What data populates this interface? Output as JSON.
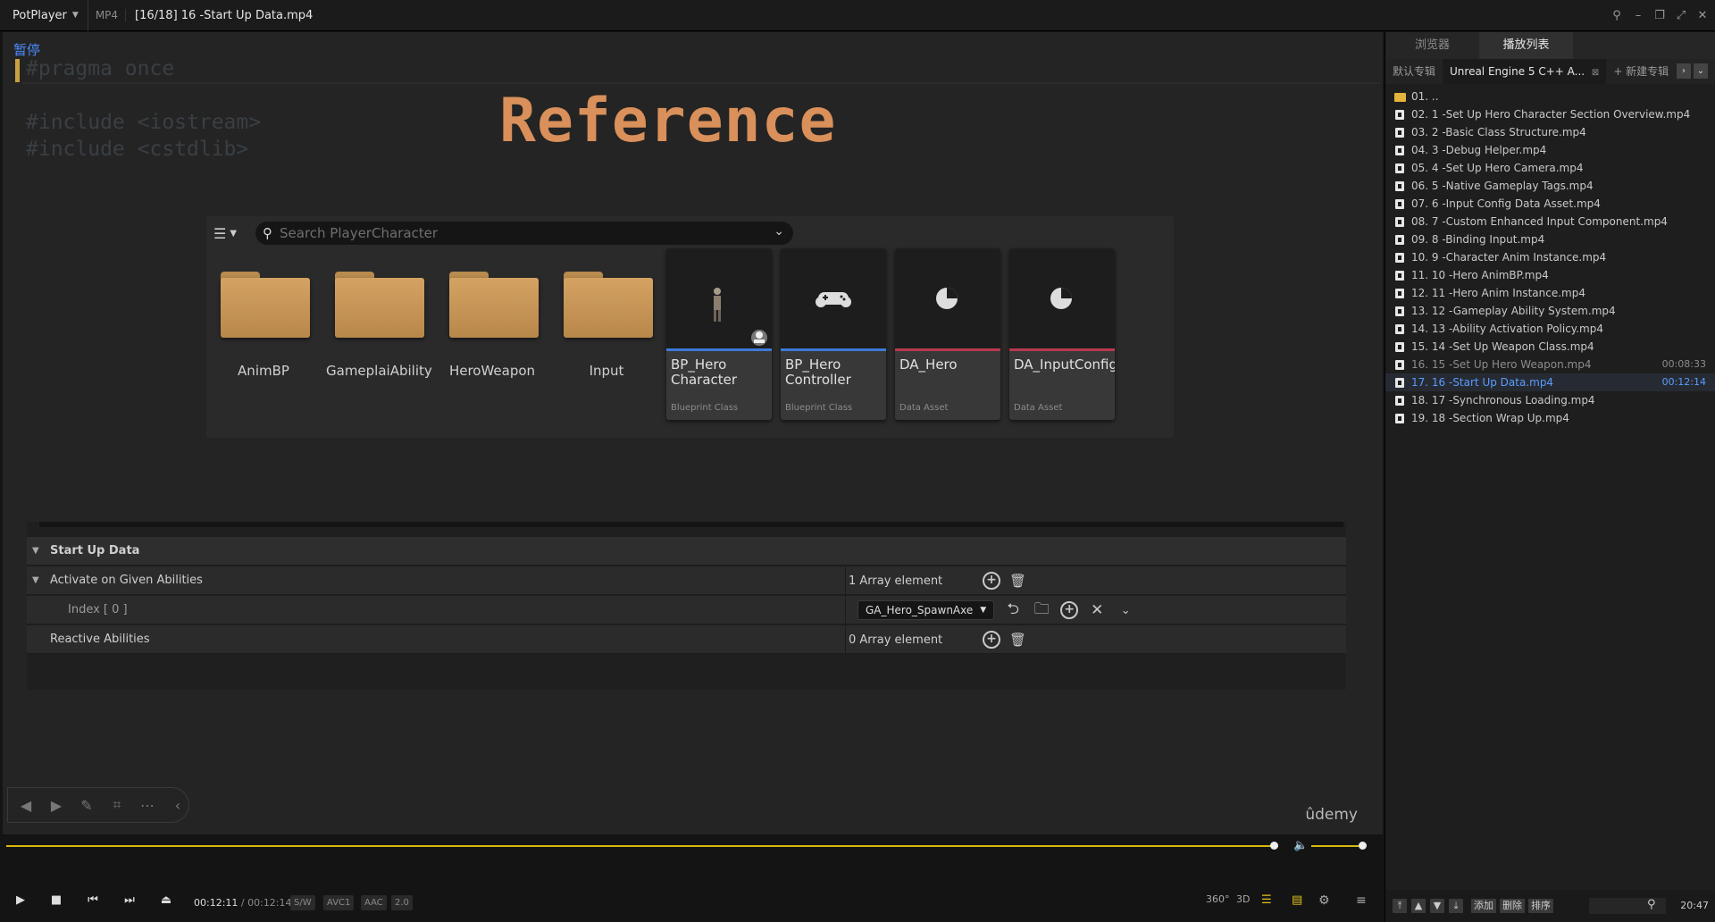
{
  "titlebar": {
    "app": "PotPlayer",
    "format": "MP4",
    "title": "[16/18] 16 -Start Up Data.mp4"
  },
  "video": {
    "osd": "暂停",
    "code": [
      "#pragma once",
      "#include <iostream>",
      "#include <cstdlib>"
    ],
    "heading": "Reference",
    "watermark": "ûdemy",
    "content_browser": {
      "search_placeholder": "Search PlayerCharacter",
      "folders": [
        "AnimBP",
        "GameplaiAbility",
        "HeroWeapon",
        "Input"
      ],
      "assets": [
        {
          "name": "BP_Hero Character",
          "kind": "Blueprint Class",
          "bar_color": "#3d7ad8"
        },
        {
          "name": "BP_Hero Controller",
          "kind": "Blueprint Class",
          "bar_color": "#3d7ad8"
        },
        {
          "name": "DA_Hero",
          "kind": "Data Asset",
          "bar_color": "#b8384e"
        },
        {
          "name": "DA_InputConfig",
          "kind": "Data Asset",
          "bar_color": "#b8384e"
        }
      ]
    },
    "details": {
      "section": "Start Up Data",
      "rows": [
        {
          "label": "Activate on Given Abilities",
          "value": "1 Array element"
        },
        {
          "label": "Index [ 0 ]",
          "value": "GA_Hero_SpawnAxe"
        },
        {
          "label": "Reactive Abilities",
          "value": "0 Array element"
        }
      ]
    }
  },
  "player": {
    "elapsed": "00:12:11",
    "duration": "00:12:14",
    "progress": 0.997,
    "volume": 0.95,
    "badges": [
      "S/W",
      "AVC1",
      "AAC",
      "2.0"
    ],
    "right_controls": [
      "360°",
      "3D"
    ]
  },
  "playlist": {
    "tabs": [
      "浏览器",
      "播放列表"
    ],
    "active_tab": 1,
    "groups": [
      "默认专辑",
      "Unreal Engine 5 C++ A...",
      "+ 新建专辑"
    ],
    "items": [
      {
        "label": "01. ..",
        "type": "folder",
        "duration": ""
      },
      {
        "label": "02. 1 -Set Up Hero Character Section Overview.mp4",
        "type": "file",
        "duration": ""
      },
      {
        "label": "03. 2 -Basic Class Structure.mp4",
        "type": "file",
        "duration": ""
      },
      {
        "label": "04. 3 -Debug Helper.mp4",
        "type": "file",
        "duration": ""
      },
      {
        "label": "05. 4 -Set Up Hero Camera.mp4",
        "type": "file",
        "duration": ""
      },
      {
        "label": "06. 5 -Native Gameplay Tags.mp4",
        "type": "file",
        "duration": ""
      },
      {
        "label": "07. 6 -Input Config Data Asset.mp4",
        "type": "file",
        "duration": ""
      },
      {
        "label": "08. 7 -Custom Enhanced Input Component.mp4",
        "type": "file",
        "duration": ""
      },
      {
        "label": "09. 8 -Binding Input.mp4",
        "type": "file",
        "duration": ""
      },
      {
        "label": "10. 9 -Character Anim Instance.mp4",
        "type": "file",
        "duration": ""
      },
      {
        "label": "11. 10 -Hero AnimBP.mp4",
        "type": "file",
        "duration": ""
      },
      {
        "label": "12. 11 -Hero Anim Instance.mp4",
        "type": "file",
        "duration": ""
      },
      {
        "label": "13. 12 -Gameplay Ability System.mp4",
        "type": "file",
        "duration": ""
      },
      {
        "label": "14. 13 -Ability Activation Policy.mp4",
        "type": "file",
        "duration": ""
      },
      {
        "label": "15. 14 -Set Up Weapon Class.mp4",
        "type": "file",
        "duration": ""
      },
      {
        "label": "16. 15 -Set Up Hero Weapon.mp4",
        "type": "file",
        "duration": "00:08:33",
        "state": "dim"
      },
      {
        "label": "17. 16 -Start Up Data.mp4",
        "type": "file",
        "duration": "00:12:14",
        "state": "current"
      },
      {
        "label": "18. 17 -Synchronous Loading.mp4",
        "type": "file",
        "duration": ""
      },
      {
        "label": "19. 18 -Section Wrap Up.mp4",
        "type": "file",
        "duration": ""
      }
    ],
    "bottom_buttons": [
      "添加",
      "删除",
      "排序"
    ],
    "clock": "20:47"
  },
  "colors": {
    "accent_seek": "#d8b90c",
    "heading": "#d9905a",
    "current_item": "#5b9bff"
  }
}
